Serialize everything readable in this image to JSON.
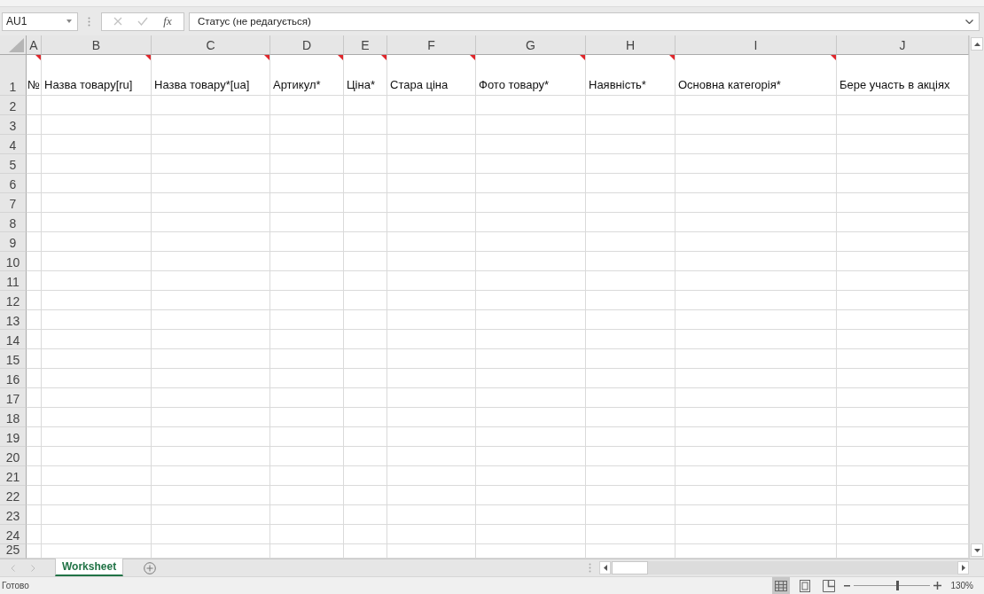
{
  "formula_bar": {
    "name_box": "AU1",
    "cancel": {
      "disabled": true
    },
    "enter": {
      "disabled": true
    },
    "function_button": "fx",
    "formula": "Статус (не редагується)"
  },
  "sheet": {
    "columns": [
      "A",
      "B",
      "C",
      "D",
      "E",
      "F",
      "G",
      "H",
      "I",
      "J"
    ],
    "rows": [
      {
        "number": "1",
        "cells": [
          {
            "text": "№",
            "comment": true
          },
          {
            "text": "Назва товару[ru]",
            "comment": true
          },
          {
            "text": "Назва товару*[ua]",
            "comment": true
          },
          {
            "text": "Артикул*",
            "comment": true
          },
          {
            "text": "Ціна*",
            "comment": true
          },
          {
            "text": "Стара ціна",
            "comment": true
          },
          {
            "text": "Фото товару*",
            "comment": true
          },
          {
            "text": "Наявність*",
            "comment": true
          },
          {
            "text": "Основна категорія*",
            "comment": true
          },
          {
            "text": "Бере участь в акціях",
            "comment": false
          }
        ]
      },
      {
        "number": "2"
      },
      {
        "number": "3"
      },
      {
        "number": "4"
      },
      {
        "number": "5"
      },
      {
        "number": "6"
      },
      {
        "number": "7"
      },
      {
        "number": "8"
      },
      {
        "number": "9"
      },
      {
        "number": "10"
      },
      {
        "number": "11"
      },
      {
        "number": "12"
      },
      {
        "number": "13"
      },
      {
        "number": "14"
      },
      {
        "number": "15"
      },
      {
        "number": "16"
      },
      {
        "number": "17"
      },
      {
        "number": "18"
      },
      {
        "number": "19"
      },
      {
        "number": "20"
      },
      {
        "number": "21"
      },
      {
        "number": "22"
      },
      {
        "number": "23"
      },
      {
        "number": "24"
      },
      {
        "number": "25"
      }
    ]
  },
  "sheet_tabs": [
    {
      "label": "Worksheet",
      "selected": true
    }
  ],
  "status_bar": {
    "status": "Готово",
    "view_buttons": [
      {
        "kind": "normal",
        "selected": true
      },
      {
        "kind": "page_layout",
        "selected": false
      },
      {
        "kind": "page_break_preview",
        "selected": false
      }
    ],
    "zoom": {
      "level": 0.57,
      "reading": "130%"
    }
  }
}
